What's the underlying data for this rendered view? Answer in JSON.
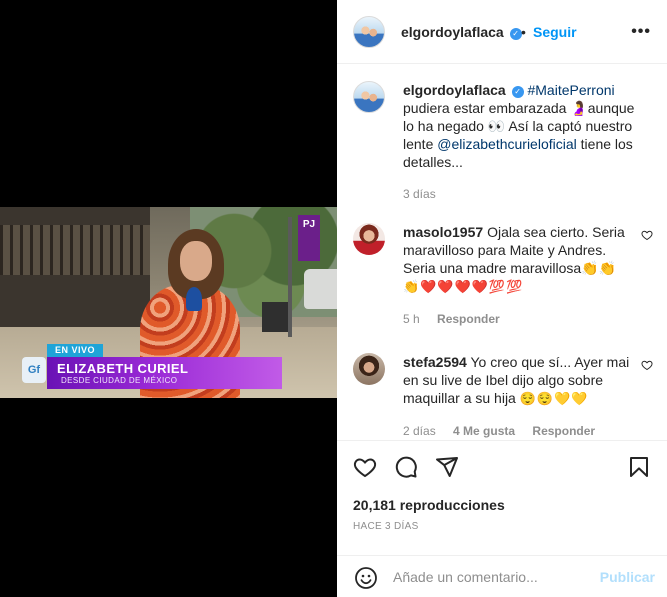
{
  "video": {
    "live_label": "EN VIVO",
    "reporter_name": "ELIZABETH CURIEL",
    "reporter_location": "DESDE CIUDAD DE MÉXICO",
    "brand_mark": "Gf",
    "channel_logo": "PJ"
  },
  "header": {
    "username": "elgordoylaflaca",
    "separator": "•",
    "follow_label": "Seguir",
    "more_icon": "more-dots-icon"
  },
  "caption": {
    "username": "elgordoylaflaca",
    "hashtag": "#MaitePerroni",
    "text_1": " pudiera estar embarazada 🤰aunque lo ha negado 👀 Así la captó nuestro lente ",
    "mention": "@elizabethcurieloficial",
    "text_2": " tiene los detalles...",
    "time": "3 días"
  },
  "comments": [
    {
      "username": "masolo1957",
      "text": "Ojala sea cierto. Seria maravilloso para Maite y Andres. Seria una madre maravillosa👏👏",
      "emojis": "👏❤️❤️❤️❤️💯💯",
      "time": "5 h",
      "reply_label": "Responder"
    },
    {
      "username": "stefa2594",
      "text": "Yo creo que sí... Ayer mai en su live de Ibel dijo algo sobre maquillar a su hija",
      "emojis": "😌😌💛💛",
      "time": "2 días",
      "likes": "4 Me gusta",
      "reply_label": "Responder"
    }
  ],
  "actions": {
    "views": "20,181 reproducciones",
    "date": "HACE 3 DÍAS"
  },
  "add_comment": {
    "placeholder": "Añade un comentario...",
    "post_label": "Publicar"
  },
  "colors": {
    "accent": "#0095f6",
    "link": "#00376b",
    "muted": "#8e8e8e",
    "verified": "#3897f0",
    "post_disabled": "#b2dffc",
    "lower_third": "#9a2ad6",
    "live_tag": "#1fa4d8"
  }
}
